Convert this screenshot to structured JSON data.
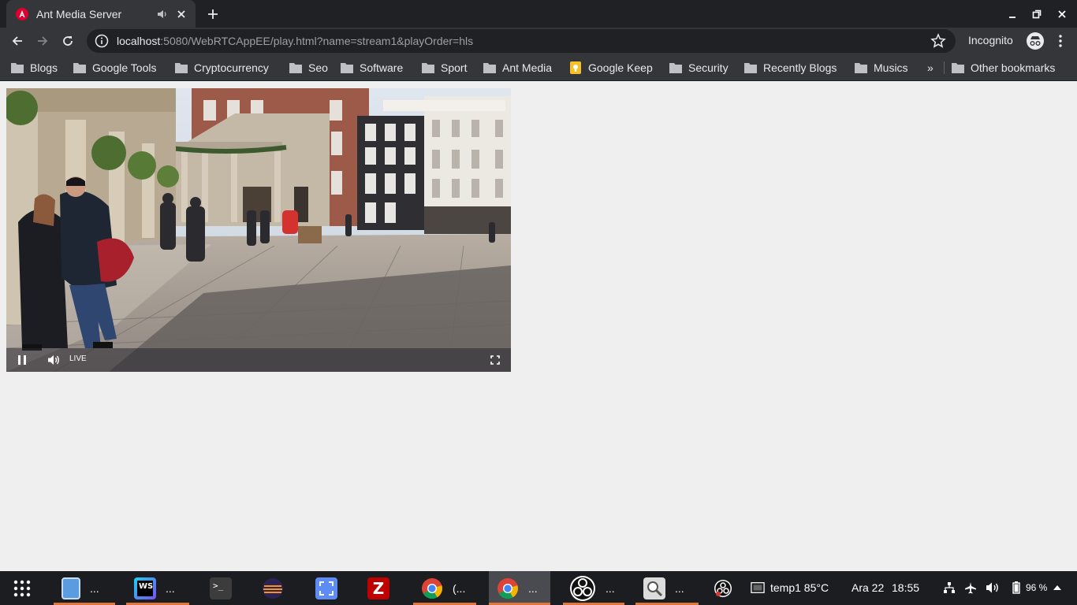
{
  "browser": {
    "tab": {
      "title": "Ant Media Server",
      "favicon": "angular-icon"
    },
    "url": {
      "host": "localhost",
      "rest": ":5080/WebRTCAppEE/play.html?name=stream1&playOrder=hls"
    },
    "profile_label": "Incognito",
    "bookmarks": [
      {
        "label": "Blogs",
        "icon": "folder-icon"
      },
      {
        "label": "Google Tools",
        "icon": "folder-icon"
      },
      {
        "label": "Cryptocurrency",
        "icon": "folder-icon"
      },
      {
        "label": "Seo",
        "icon": "folder-icon"
      },
      {
        "label": "Software",
        "icon": "folder-icon"
      },
      {
        "label": "Sport",
        "icon": "folder-icon"
      },
      {
        "label": "Ant Media",
        "icon": "folder-icon"
      },
      {
        "label": "Google Keep",
        "icon": "google-keep-icon"
      },
      {
        "label": "Security",
        "icon": "folder-icon"
      },
      {
        "label": "Recently Blogs",
        "icon": "folder-icon"
      },
      {
        "label": "Musics",
        "icon": "folder-icon"
      }
    ],
    "bookmarks_overflow": "»",
    "other_bookmarks": "Other bookmarks"
  },
  "player": {
    "live_label": "LIVE",
    "state": "playing"
  },
  "taskbar": {
    "apps": [
      {
        "name": "file-manager",
        "label": "..."
      },
      {
        "name": "webstorm",
        "label": "..."
      },
      {
        "name": "terminal",
        "label": ""
      },
      {
        "name": "eclipse",
        "label": ""
      },
      {
        "name": "screenshot-tool",
        "label": ""
      },
      {
        "name": "filezilla",
        "label": ""
      },
      {
        "name": "chrome",
        "label": "(..."
      },
      {
        "name": "chrome-incognito",
        "label": "..."
      },
      {
        "name": "obs-studio",
        "label": "..."
      },
      {
        "name": "image-viewer",
        "label": "..."
      }
    ],
    "temp": "temp1 85°C",
    "date": "Ara 22",
    "time": "18:55",
    "battery": "96 %"
  },
  "colors": {
    "accent": "#e0763c",
    "chrome_dark": "#202124",
    "chrome_mid": "#35363a"
  }
}
